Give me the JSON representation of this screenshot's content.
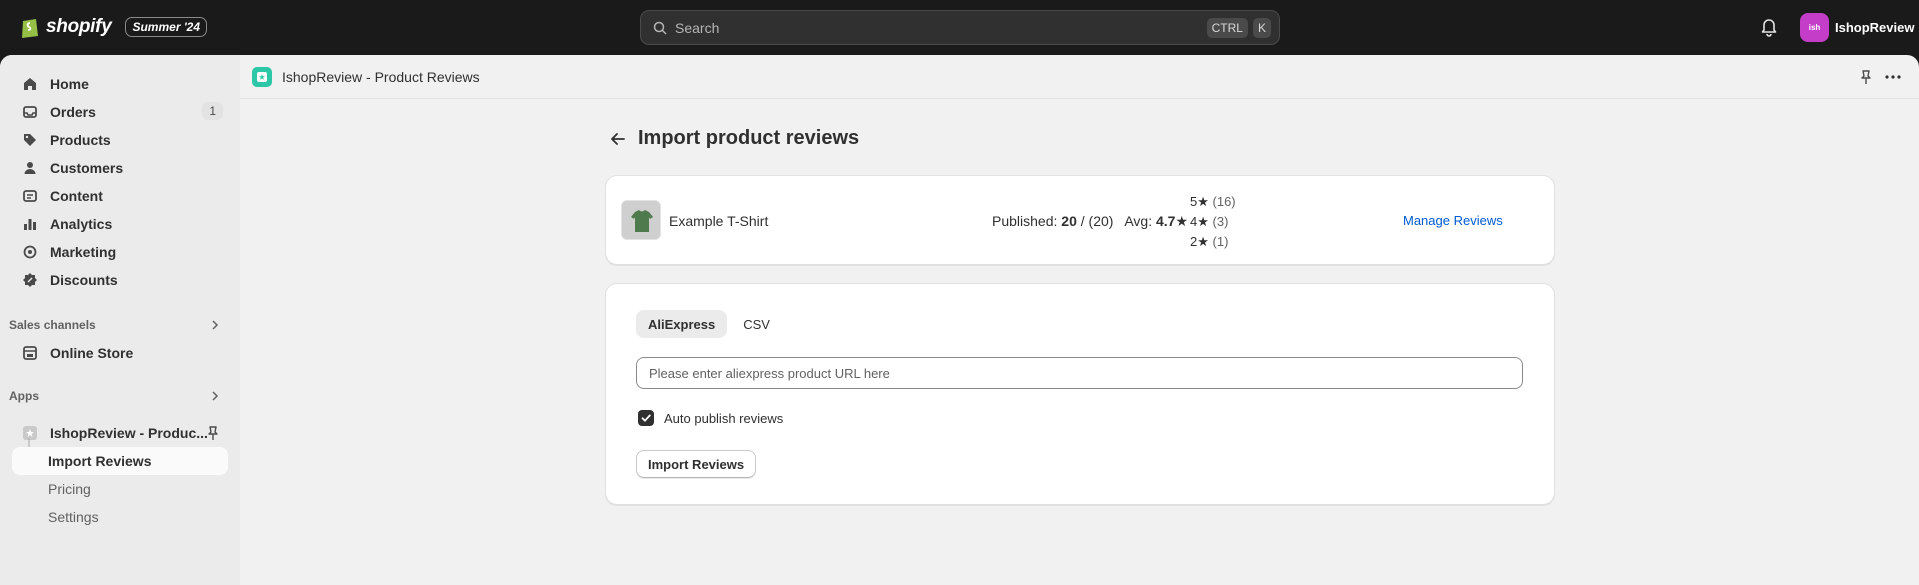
{
  "topbar": {
    "brand": "shopify",
    "edition": "Summer '24",
    "search_placeholder": "Search",
    "shortcut_keys": [
      "CTRL",
      "K"
    ],
    "account_initials": "ish",
    "account_name": "IshopReview",
    "avatar_color": "#c43dc9"
  },
  "sidebar": {
    "items": [
      {
        "label": "Home",
        "icon": "home-icon"
      },
      {
        "label": "Orders",
        "icon": "orders-icon",
        "badge": "1"
      },
      {
        "label": "Products",
        "icon": "tag-icon"
      },
      {
        "label": "Customers",
        "icon": "person-icon"
      },
      {
        "label": "Content",
        "icon": "content-icon"
      },
      {
        "label": "Analytics",
        "icon": "bar-chart-icon"
      },
      {
        "label": "Marketing",
        "icon": "target-icon"
      },
      {
        "label": "Discounts",
        "icon": "discount-icon"
      }
    ],
    "sales_channels_label": "Sales channels",
    "online_store_label": "Online Store",
    "apps_label": "Apps",
    "app_name": "IshopReview - Produc...",
    "app_subitems": [
      "Import Reviews",
      "Pricing",
      "Settings"
    ]
  },
  "app_header": {
    "title": "IshopReview - Product Reviews",
    "app_icon_color": "#2bc7a6"
  },
  "page": {
    "title": "Import product reviews"
  },
  "product_card": {
    "name": "Example T-Shirt",
    "published_label": "Published:",
    "published_count": "20",
    "published_total": "/ (20)",
    "avg_label": "Avg:",
    "avg_value": "4.7★",
    "distribution": [
      {
        "stars": "5★",
        "count": "(16)"
      },
      {
        "stars": "4★",
        "count": "(3)"
      },
      {
        "stars": "2★",
        "count": "(1)"
      }
    ],
    "manage_link": "Manage Reviews",
    "link_color": "#005bd3"
  },
  "import_card": {
    "tabs": [
      "AliExpress",
      "CSV"
    ],
    "active_tab": "AliExpress",
    "url_placeholder": "Please enter aliexpress product URL here",
    "auto_publish_label": "Auto publish reviews",
    "auto_publish_checked": true,
    "import_button": "Import Reviews"
  }
}
